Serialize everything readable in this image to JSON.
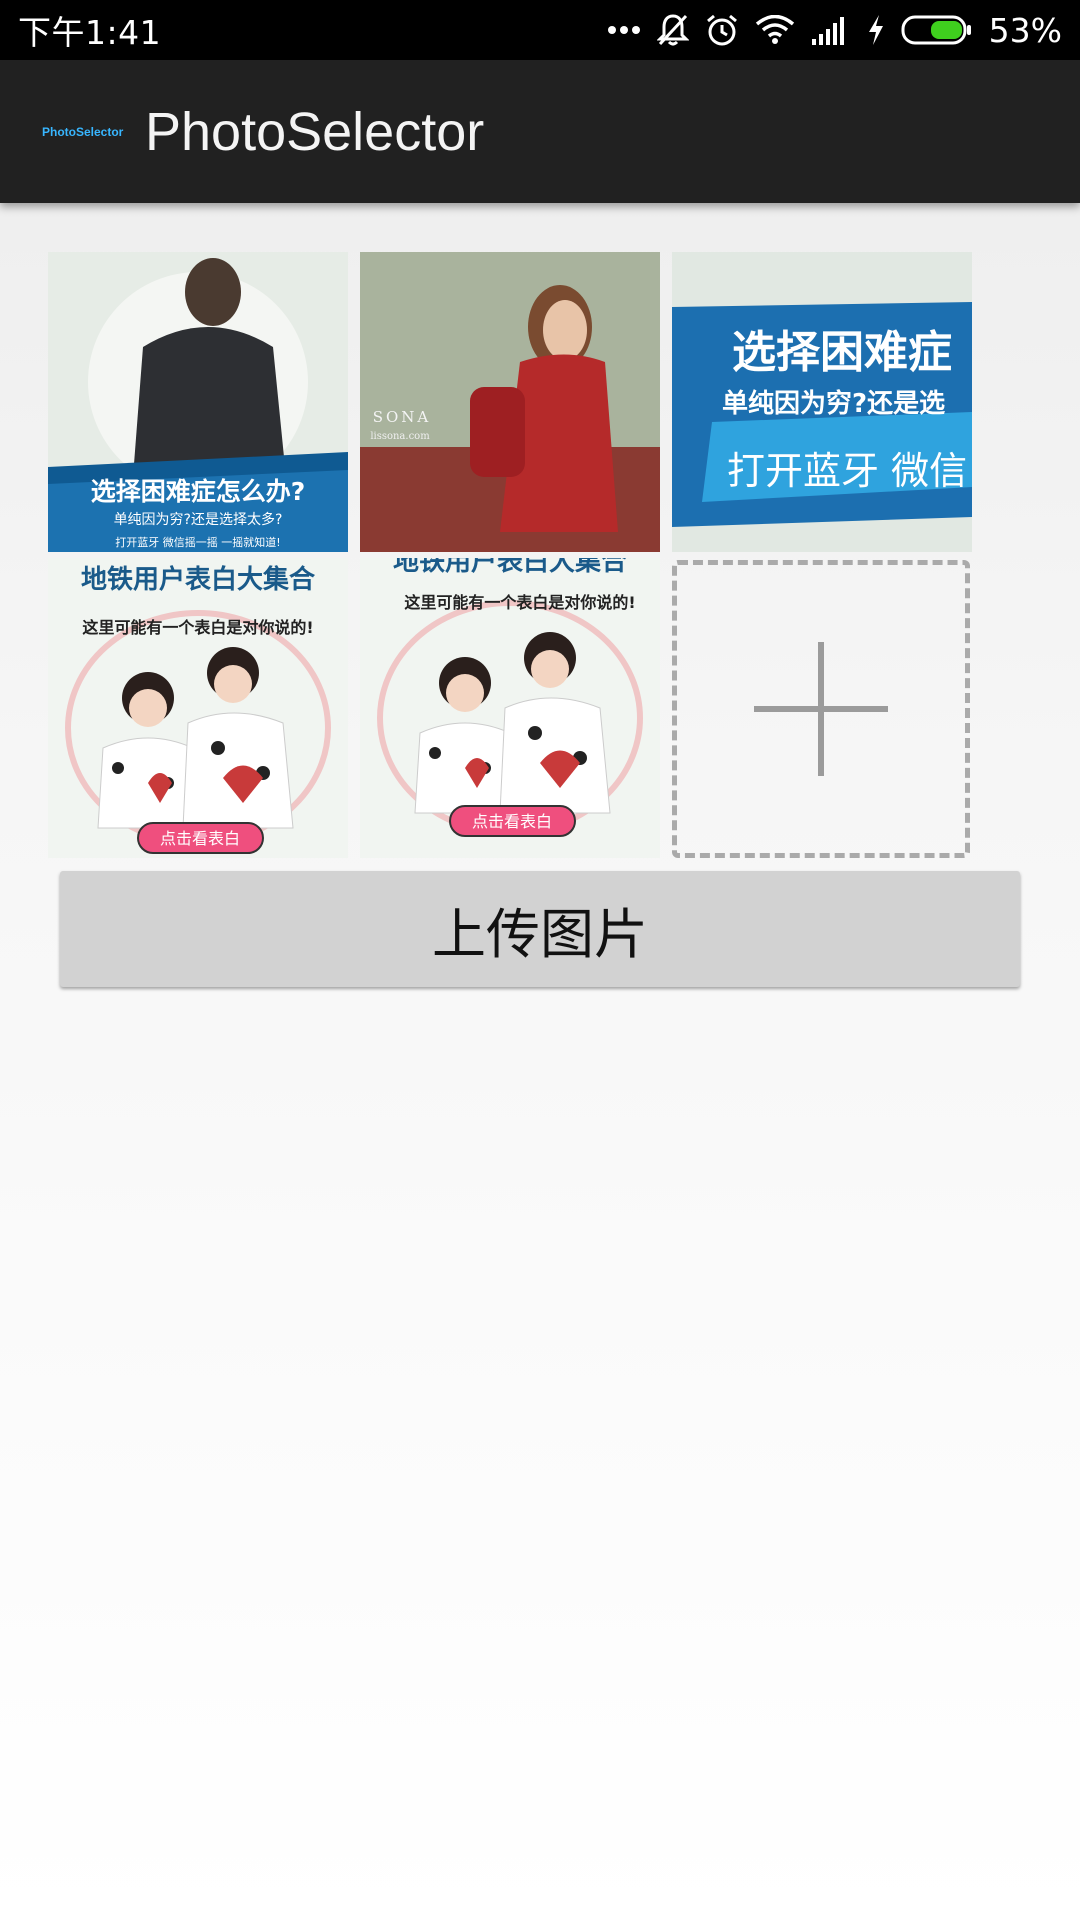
{
  "status_bar": {
    "time": "下午1:41",
    "battery_percent": "53%",
    "battery_level": 0.53,
    "icons": [
      "more-dots-icon",
      "bell-off-icon",
      "alarm-icon",
      "wifi-icon",
      "signal-icon",
      "charging-icon",
      "battery-icon"
    ]
  },
  "app_bar": {
    "logo_text": "PhotoSelector",
    "title": "PhotoSelector"
  },
  "photos": [
    {
      "caption_main": "选择困难症怎么办?",
      "caption_sub": "单纯因为穷?还是选择太多?",
      "caption_foot": "打开蓝牙  微信摇一摇  一摇就知道!"
    },
    {
      "caption_main": "SONA",
      "caption_sub": "lissona.com"
    },
    {
      "caption_main": "选择困难症",
      "caption_sub": "单纯因为穷?还是选",
      "caption_foot": "打开蓝牙  微信"
    },
    {
      "caption_main": "地铁用户表白大集合",
      "caption_sub": "这里可能有一个表白是对你说的!",
      "caption_foot": "点击看表白"
    },
    {
      "caption_main": "地铁用户表白大集合",
      "caption_sub": "这里可能有一个表白是对你说的!",
      "caption_foot": "点击看表白"
    }
  ],
  "add_tile": {
    "icon": "plus-icon"
  },
  "upload_button": {
    "label": "上传图片"
  },
  "colors": {
    "app_bar": "#212121",
    "status_bar": "#000000",
    "logo": "#38b6ff",
    "button": "#d2d2d2",
    "dashed_border": "#aaaaaa"
  }
}
